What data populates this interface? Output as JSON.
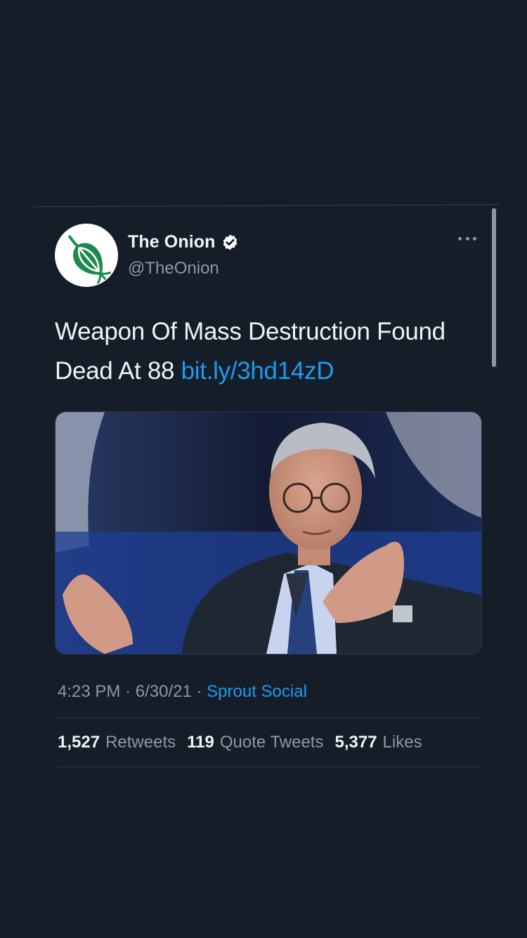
{
  "tweet": {
    "author": {
      "display_name": "The Onion",
      "handle": "@TheOnion",
      "verified": true,
      "avatar_icon": "onion-logo-icon"
    },
    "more_icon": "more-horizontal-icon",
    "text": "Weapon Of Mass Destruction Found Dead At 88",
    "link": "bit.ly/3hd14zD",
    "media": {
      "type": "photo",
      "alt": ""
    },
    "timestamp": {
      "time": "4:23 PM",
      "separator": "·",
      "date": "6/30/21",
      "source": "Sprout Social"
    },
    "stats": {
      "retweets_count": "1,527",
      "retweets_label": "Retweets",
      "quote_tweets_count": "119",
      "quote_tweets_label": "Quote Tweets",
      "likes_count": "5,377",
      "likes_label": "Likes"
    }
  },
  "colors": {
    "background": "#151d28",
    "link": "#1d9bf0",
    "secondary_text": "#8b98a5",
    "onion_green": "#1b8a4a"
  }
}
